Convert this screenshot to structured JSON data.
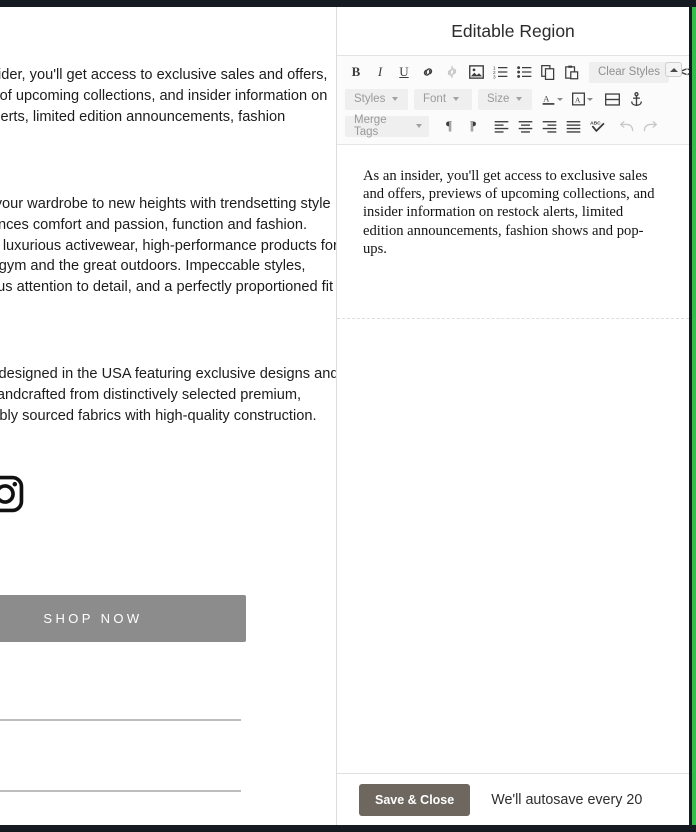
{
  "chrome": {
    "accent_color": "#2fbf4a",
    "bar_color": "#161b22"
  },
  "preview": {
    "paragraph_1": "As an insider, you'll get access to exclusive sales and offers, previews of upcoming collections, and insider information on restock alerts, limited edition announcements, fashion",
    "paragraph_2": "Elevate your wardrobe to new heights with trendsetting style that balances comfort and passion, function and fashion. Discover luxurious activewear, high-performance products for both the gym and the great outdoors. Impeccable styles, scrupulous attention to detail, and a perfectly proportioned fit for up to",
    "paragraph_3": "Proudly designed in the USA featuring exclusive designs and prints, handcrafted from distinctively selected premium, sustainably sourced fabrics with high-quality construction.",
    "instagram_label": "Instagram",
    "shop_button_label": "SHOP NOW"
  },
  "editor": {
    "title": "Editable Region",
    "toolbar": {
      "row1": [
        {
          "name": "bold-icon",
          "label": "B"
        },
        {
          "name": "italic-icon",
          "label": "I"
        },
        {
          "name": "underline-icon",
          "label": "U"
        },
        {
          "name": "link-icon",
          "label": "Link"
        },
        {
          "name": "unlink-icon",
          "label": "Unlink"
        },
        {
          "name": "image-icon",
          "label": "Insert Image"
        },
        {
          "name": "ordered-list-icon",
          "label": "Numbered List"
        },
        {
          "name": "unordered-list-icon",
          "label": "Bulleted List"
        },
        {
          "name": "copy-icon",
          "label": "Copy"
        },
        {
          "name": "paste-icon",
          "label": "Paste"
        }
      ],
      "clear_styles_label": "Clear Styles",
      "source_code_label": "<>",
      "row2": {
        "styles_label": "Styles",
        "font_label": "Font",
        "size_label": "Size",
        "text_color_label": "A",
        "background_color_label": "A",
        "table_label": "Table",
        "anchor_label": "Anchor"
      },
      "row3": {
        "merge_tags_label": "Merge Tags",
        "ltr_label": "LTR Paragraph",
        "rtl_label": "RTL Paragraph",
        "align_left_label": "Align Left",
        "align_center_label": "Align Center",
        "align_right_label": "Align Right",
        "justify_label": "Justify",
        "spellcheck_label": "Spell Check",
        "undo_label": "Undo",
        "redo_label": "Redo"
      }
    },
    "content_text": "As an insider, you'll get access to exclusive sales and offers, previews of upcoming collections, and insider information on restock alerts, limited edition announcements, fashion shows and pop-ups.",
    "footer": {
      "save_label": "Save & Close",
      "autosave_note": "We'll autosave every 20"
    }
  }
}
